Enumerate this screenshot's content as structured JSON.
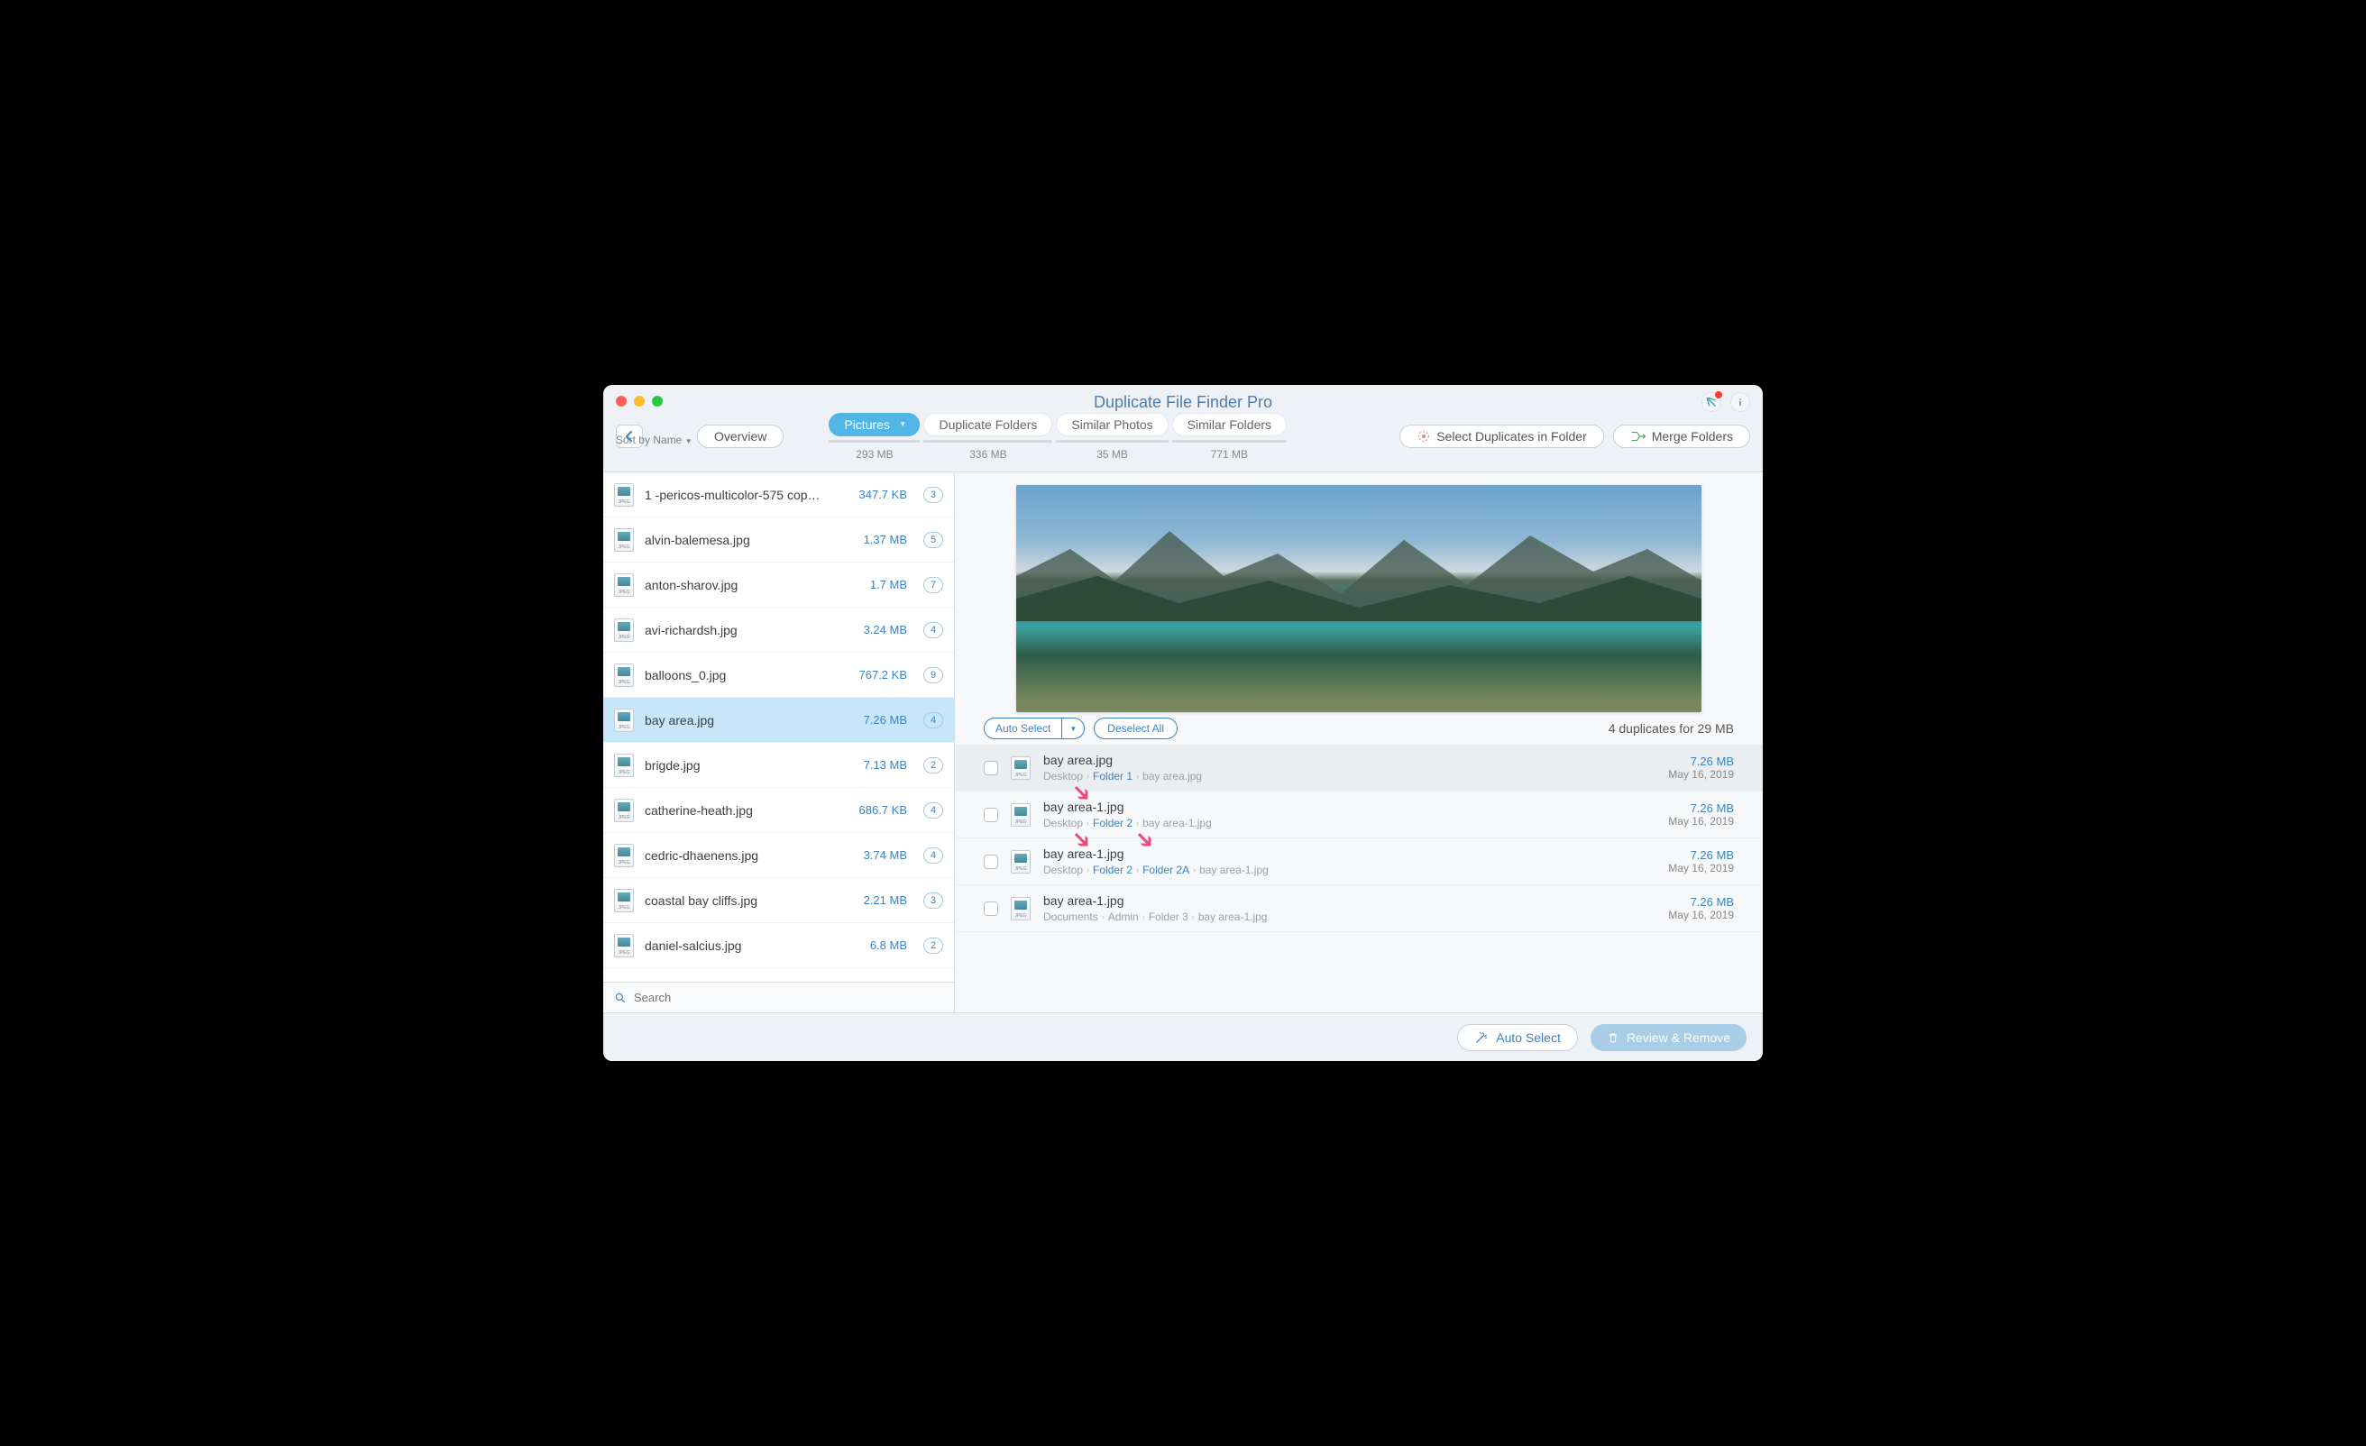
{
  "app": {
    "title": "Duplicate File Finder Pro"
  },
  "nav": {
    "overview": "Overview",
    "select_dup": "Select Duplicates in Folder",
    "merge": "Merge Folders"
  },
  "tabs": [
    {
      "label": "Pictures",
      "size": "293 MB",
      "active": true
    },
    {
      "label": "Duplicate Folders",
      "size": "336 MB",
      "active": false
    },
    {
      "label": "Similar Photos",
      "size": "35 MB",
      "active": false
    },
    {
      "label": "Similar Folders",
      "size": "771 MB",
      "active": false
    }
  ],
  "sort": {
    "label": "Sort by Name"
  },
  "files": [
    {
      "name": "1 -pericos-multicolor-575 cop…",
      "size": "347.7 KB",
      "count": "3",
      "selected": false
    },
    {
      "name": "alvin-balemesa.jpg",
      "size": "1.37 MB",
      "count": "5",
      "selected": false
    },
    {
      "name": "anton-sharov.jpg",
      "size": "1.7 MB",
      "count": "7",
      "selected": false
    },
    {
      "name": "avi-richardsh.jpg",
      "size": "3.24 MB",
      "count": "4",
      "selected": false
    },
    {
      "name": "balloons_0.jpg",
      "size": "767.2 KB",
      "count": "9",
      "selected": false
    },
    {
      "name": "bay area.jpg",
      "size": "7.26 MB",
      "count": "4",
      "selected": true
    },
    {
      "name": "brigde.jpg",
      "size": "7.13 MB",
      "count": "2",
      "selected": false
    },
    {
      "name": "catherine-heath.jpg",
      "size": "686.7 KB",
      "count": "4",
      "selected": false
    },
    {
      "name": "cedric-dhaenens.jpg",
      "size": "3.74 MB",
      "count": "4",
      "selected": false
    },
    {
      "name": "coastal bay cliffs.jpg",
      "size": "2.21 MB",
      "count": "3",
      "selected": false
    },
    {
      "name": "daniel-salcius.jpg",
      "size": "6.8 MB",
      "count": "2",
      "selected": false
    }
  ],
  "search": {
    "placeholder": "Search"
  },
  "detail": {
    "auto_select": "Auto Select",
    "deselect": "Deselect All",
    "summary": "4 duplicates for 29 MB",
    "duplicates": [
      {
        "name": "bay area.jpg",
        "path": [
          "Desktop",
          "Folder 1",
          "bay area.jpg"
        ],
        "size": "7.26 MB",
        "date": "May 16, 2019",
        "hl": [
          1
        ]
      },
      {
        "name": "bay area-1.jpg",
        "path": [
          "Desktop",
          "Folder 2",
          "bay area-1.jpg"
        ],
        "size": "7.26 MB",
        "date": "May 16, 2019",
        "hl": [
          1
        ],
        "arrow": true
      },
      {
        "name": "bay area-1.jpg",
        "path": [
          "Desktop",
          "Folder 2",
          "Folder 2A",
          "bay area-1.jpg"
        ],
        "size": "7.26 MB",
        "date": "May 16, 2019",
        "hl": [
          1,
          2
        ],
        "arrow2": true
      },
      {
        "name": "bay area-1.jpg",
        "path": [
          "Documents",
          "Admin",
          "Folder 3",
          "bay area-1.jpg"
        ],
        "size": "7.26 MB",
        "date": "May 16, 2019",
        "hl": []
      }
    ]
  },
  "footer": {
    "auto": "Auto Select",
    "review": "Review & Remove"
  },
  "icon_tag": "JPEG"
}
